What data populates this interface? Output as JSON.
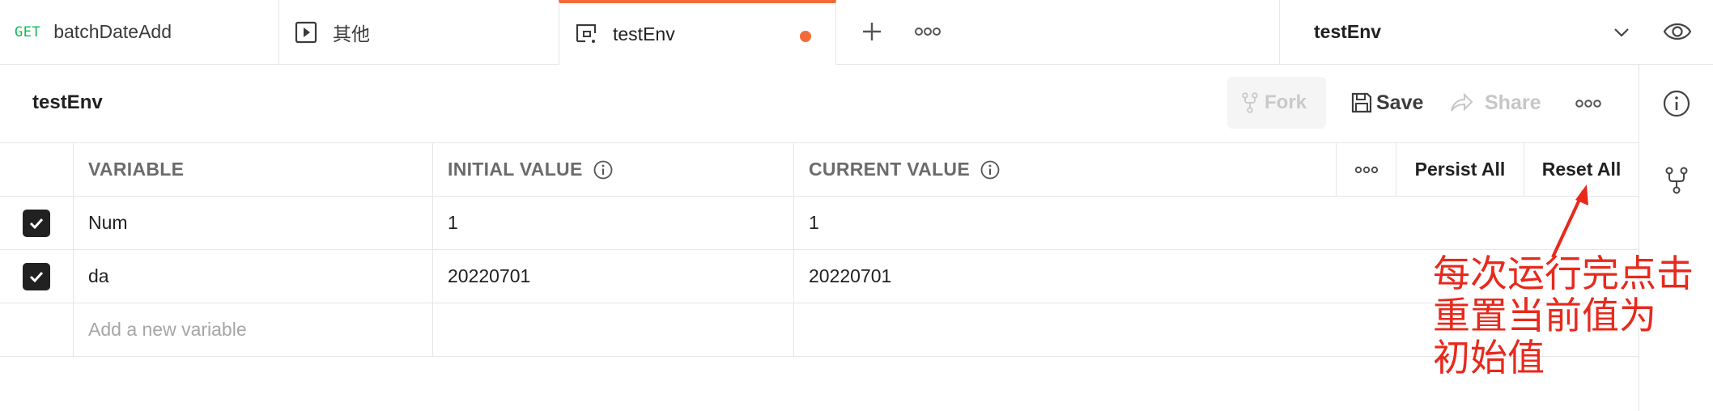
{
  "tabs": [
    {
      "method": "GET",
      "label": "batchDateAdd"
    },
    {
      "label": "其他"
    },
    {
      "label": "testEnv",
      "unsaved": true
    }
  ],
  "environment_selector": {
    "selected": "testEnv"
  },
  "page": {
    "title": "testEnv"
  },
  "actions": {
    "fork": "Fork",
    "save": "Save",
    "share": "Share"
  },
  "table": {
    "headers": {
      "variable": "VARIABLE",
      "initial": "INITIAL VALUE",
      "current": "CURRENT VALUE"
    },
    "persist_all": "Persist All",
    "reset_all": "Reset All",
    "rows": [
      {
        "checked": true,
        "variable": "Num",
        "initial": "1",
        "current": "1"
      },
      {
        "checked": true,
        "variable": "da",
        "initial": "20220701",
        "current": "20220701"
      }
    ],
    "new_placeholder": "Add a new variable"
  },
  "annotation": {
    "lines": [
      "每次运行完点击",
      "重置当前值为",
      "初始值"
    ],
    "color": "#e8291c"
  },
  "colors": {
    "accent": "#f26b3a",
    "get_method": "#0cbb52"
  }
}
